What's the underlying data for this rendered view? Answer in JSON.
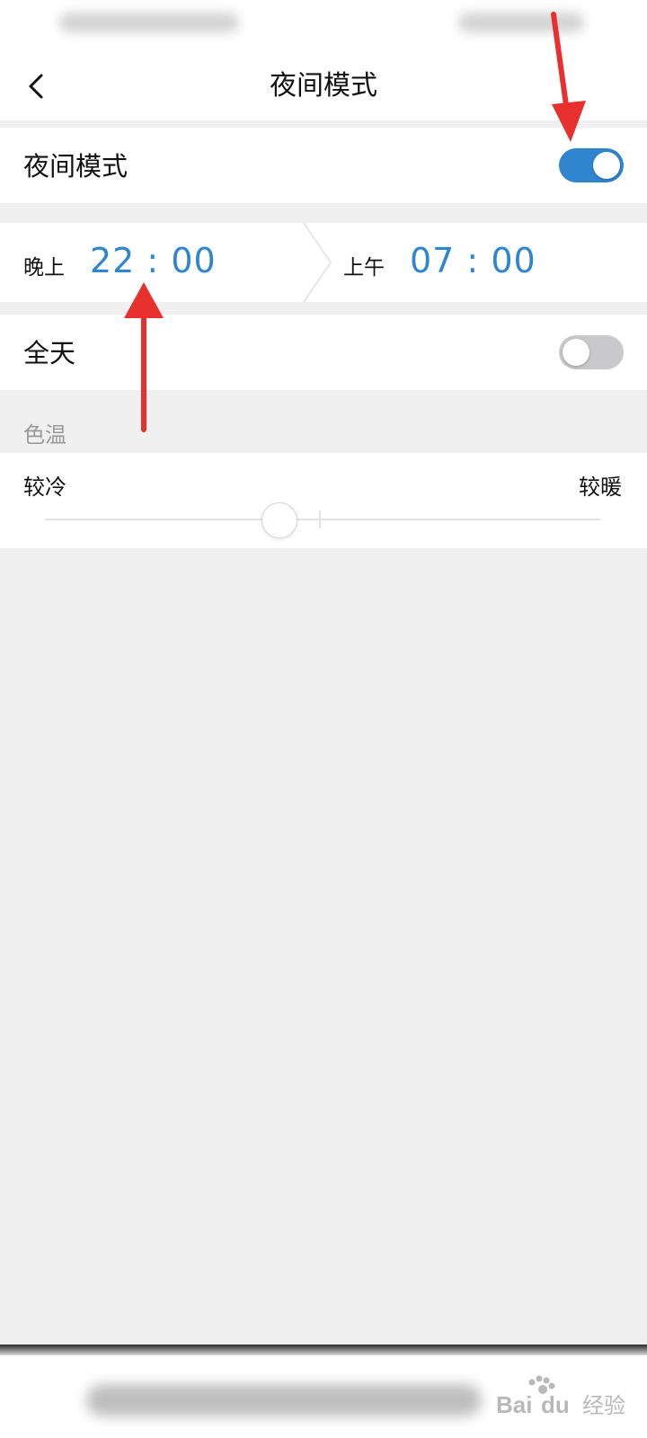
{
  "header": {
    "title": "夜间模式",
    "back_icon": "chevron-left-icon"
  },
  "night_mode": {
    "label": "夜间模式",
    "enabled": true,
    "toggle_on_color": "#2f86cf"
  },
  "schedule": {
    "start": {
      "prefix": "晚上",
      "time": "22 : 00"
    },
    "end": {
      "prefix": "上午",
      "time": "07 : 00"
    },
    "time_color": "#2f86cf"
  },
  "all_day": {
    "label": "全天",
    "enabled": false,
    "toggle_off_color": "#c9c9cc"
  },
  "color_temperature": {
    "section_label": "色温",
    "left_label": "较冷",
    "right_label": "较暖",
    "value_fraction": 0.42
  },
  "annotation_color": "#e8312f",
  "watermark": {
    "text": "Bai du 经验"
  }
}
